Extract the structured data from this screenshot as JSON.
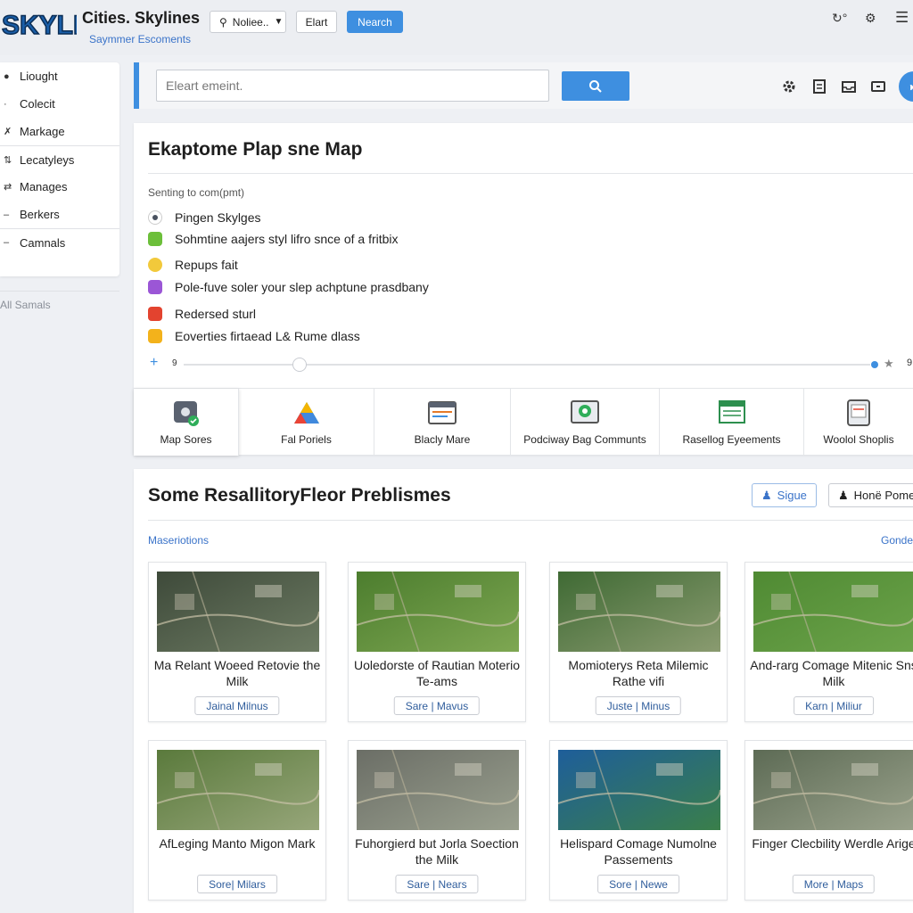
{
  "app": {
    "title": "Cities. Skylines",
    "subtitle": "Saymmer Escoments",
    "logo_text": "SKYLINES"
  },
  "topbar": {
    "select_value": "Noliee..",
    "button1": "Elart",
    "button2": "Nearch"
  },
  "sidebar": {
    "items": [
      {
        "label": "Liought",
        "icon": "person-icon"
      },
      {
        "label": "Colecit",
        "icon": "list-icon"
      },
      {
        "label": "Markage",
        "icon": "tools-icon"
      },
      {
        "label": "Lecatyleys",
        "icon": "arrows-icon"
      },
      {
        "label": "Manages",
        "icon": "swap-icon"
      },
      {
        "label": "Berkers",
        "icon": "minus-icon"
      },
      {
        "label": "Camnals",
        "icon": "dash-icon"
      }
    ],
    "footer": "All Samals"
  },
  "search": {
    "placeholder": "Eleart emeint."
  },
  "panel": {
    "title": "Ekaptome Plap sne Map",
    "sub_label": "Senting to com(pmt)",
    "options": [
      {
        "label": "Pingen Skylges",
        "color": "#4a5260"
      },
      {
        "label": "Sohmtine aajers styl lifro snce of a fritbix",
        "color": "#6cbf3a"
      },
      {
        "label": "Repups fait",
        "color": "#f2c93b"
      },
      {
        "label": "Pole-fuve soler your slep achptune prasdbany",
        "color": "#9b56d6"
      },
      {
        "label": "Redersed sturl",
        "color": "#e3432f"
      },
      {
        "label": "Eoverties firtaead L& Rume dlass",
        "color": "#f3b21b"
      }
    ],
    "slider": {
      "left_label": "9",
      "right_label": "9",
      "value_fraction": 0.17
    },
    "categories": [
      {
        "label": "Map Sores",
        "icon": "map-pin-icon"
      },
      {
        "label": "Fal Poriels",
        "icon": "triangle-icon"
      },
      {
        "label": "Blacly Mare",
        "icon": "window-icon"
      },
      {
        "label": "Podciway Bag Communts",
        "icon": "location-badge-icon"
      },
      {
        "label": "Rasellog Eyeements",
        "icon": "sheet-icon"
      },
      {
        "label": "Woolol Shoplis",
        "icon": "tablet-icon"
      }
    ]
  },
  "results": {
    "title": "Some ResallitoryFleor Preblismes",
    "button_signup": "Sigue",
    "button_home": "Honë Pome",
    "link_left": "Maseriotions",
    "link_right": "Gonde",
    "tiles": [
      {
        "title": "Ma Relant Woeed Retovie the Milk",
        "tag": "Jainal Milnus",
        "colors": [
          "#3e4a3a",
          "#6d7b63"
        ]
      },
      {
        "title": "Uoledorste of Rautian Moterio Te-ams",
        "tag": "Sare | Mavus",
        "colors": [
          "#4c7d2e",
          "#7ea752"
        ]
      },
      {
        "title": "Momioterys Reta Milemic Rathe vifi",
        "tag": "Juste | Minus",
        "colors": [
          "#3f6a34",
          "#8a9b70"
        ]
      },
      {
        "title": "And-rarg Comage Mitenic Sns Milk",
        "tag": "Karn | Miliur",
        "colors": [
          "#4f8a33",
          "#6ca34a"
        ]
      },
      {
        "title": "AfLeging Manto Migon Mark",
        "tag": "Sore| Milars",
        "colors": [
          "#5a7a3c",
          "#97a67a"
        ]
      },
      {
        "title": "Fuhorgierd but Jorla Soection the Milk",
        "tag": "Sare | Nears",
        "colors": [
          "#6b6e66",
          "#9aa08f"
        ]
      },
      {
        "title": "Helispard Comage Numolne Passements",
        "tag": "Sore | Newe",
        "colors": [
          "#1e5e9a",
          "#3a7f4a"
        ]
      },
      {
        "title": "Finger Clecbility Werdle Arige",
        "tag": "More | Maps",
        "colors": [
          "#5d6b55",
          "#9aa28c"
        ]
      }
    ]
  }
}
